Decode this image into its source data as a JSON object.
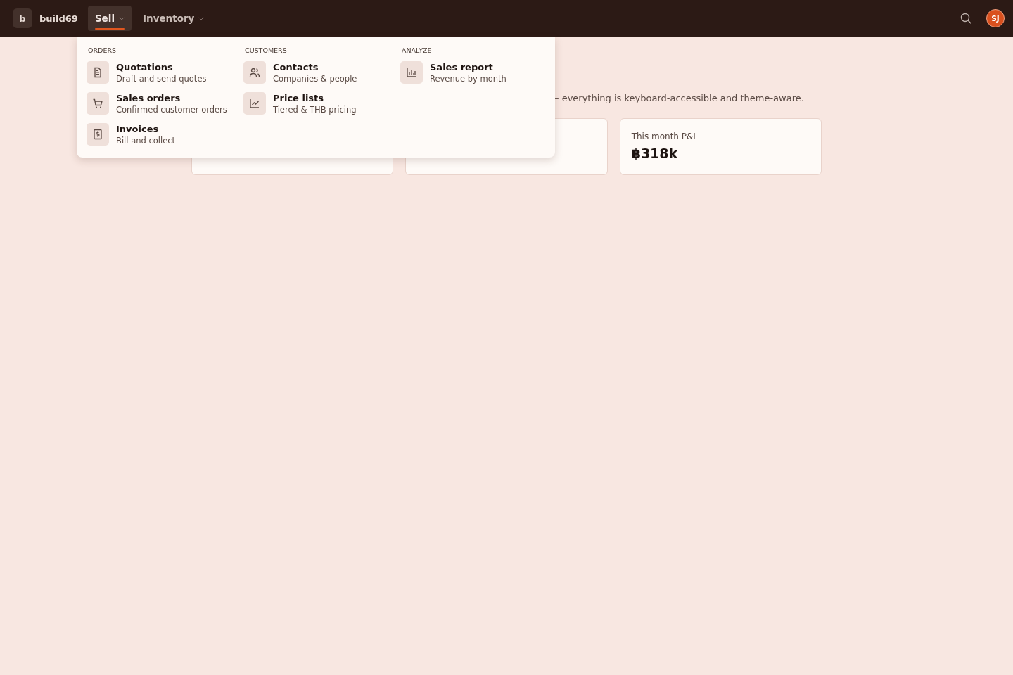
{
  "brand": {
    "logo": "b",
    "name": "build69"
  },
  "nav": [
    {
      "label": "Sell",
      "selected": true,
      "expanded": true
    },
    {
      "label": "Inventory",
      "selected": false,
      "expanded": false
    }
  ],
  "user": {
    "initials": "SJ"
  },
  "menu": {
    "columns": [
      {
        "heading": "ORDERS",
        "items": [
          {
            "kind": "document",
            "title": "Quotations",
            "subtitle": "Draft and send quotes"
          },
          {
            "kind": "cart",
            "title": "Sales orders",
            "subtitle": "Confirmed customer orders"
          },
          {
            "kind": "invoice",
            "title": "Invoices",
            "subtitle": "Bill and collect"
          }
        ]
      },
      {
        "heading": "CUSTOMERS",
        "items": [
          {
            "kind": "people",
            "title": "Contacts",
            "subtitle": "Companies & people"
          },
          {
            "kind": "linechart",
            "title": "Price lists",
            "subtitle": "Tiered & THB pricing"
          }
        ]
      },
      {
        "heading": "ANALYZE",
        "items": [
          {
            "kind": "barchart",
            "title": "Sales report",
            "subtitle": "Revenue by month"
          }
        ]
      }
    ]
  },
  "subtitle": "– everything is keyboard-accessible and theme-aware.",
  "cards": [
    {
      "kind": "covered"
    },
    {
      "kind": "covered"
    },
    {
      "kind": "stat",
      "label": "This month P&L",
      "value": "฿318k"
    }
  ]
}
